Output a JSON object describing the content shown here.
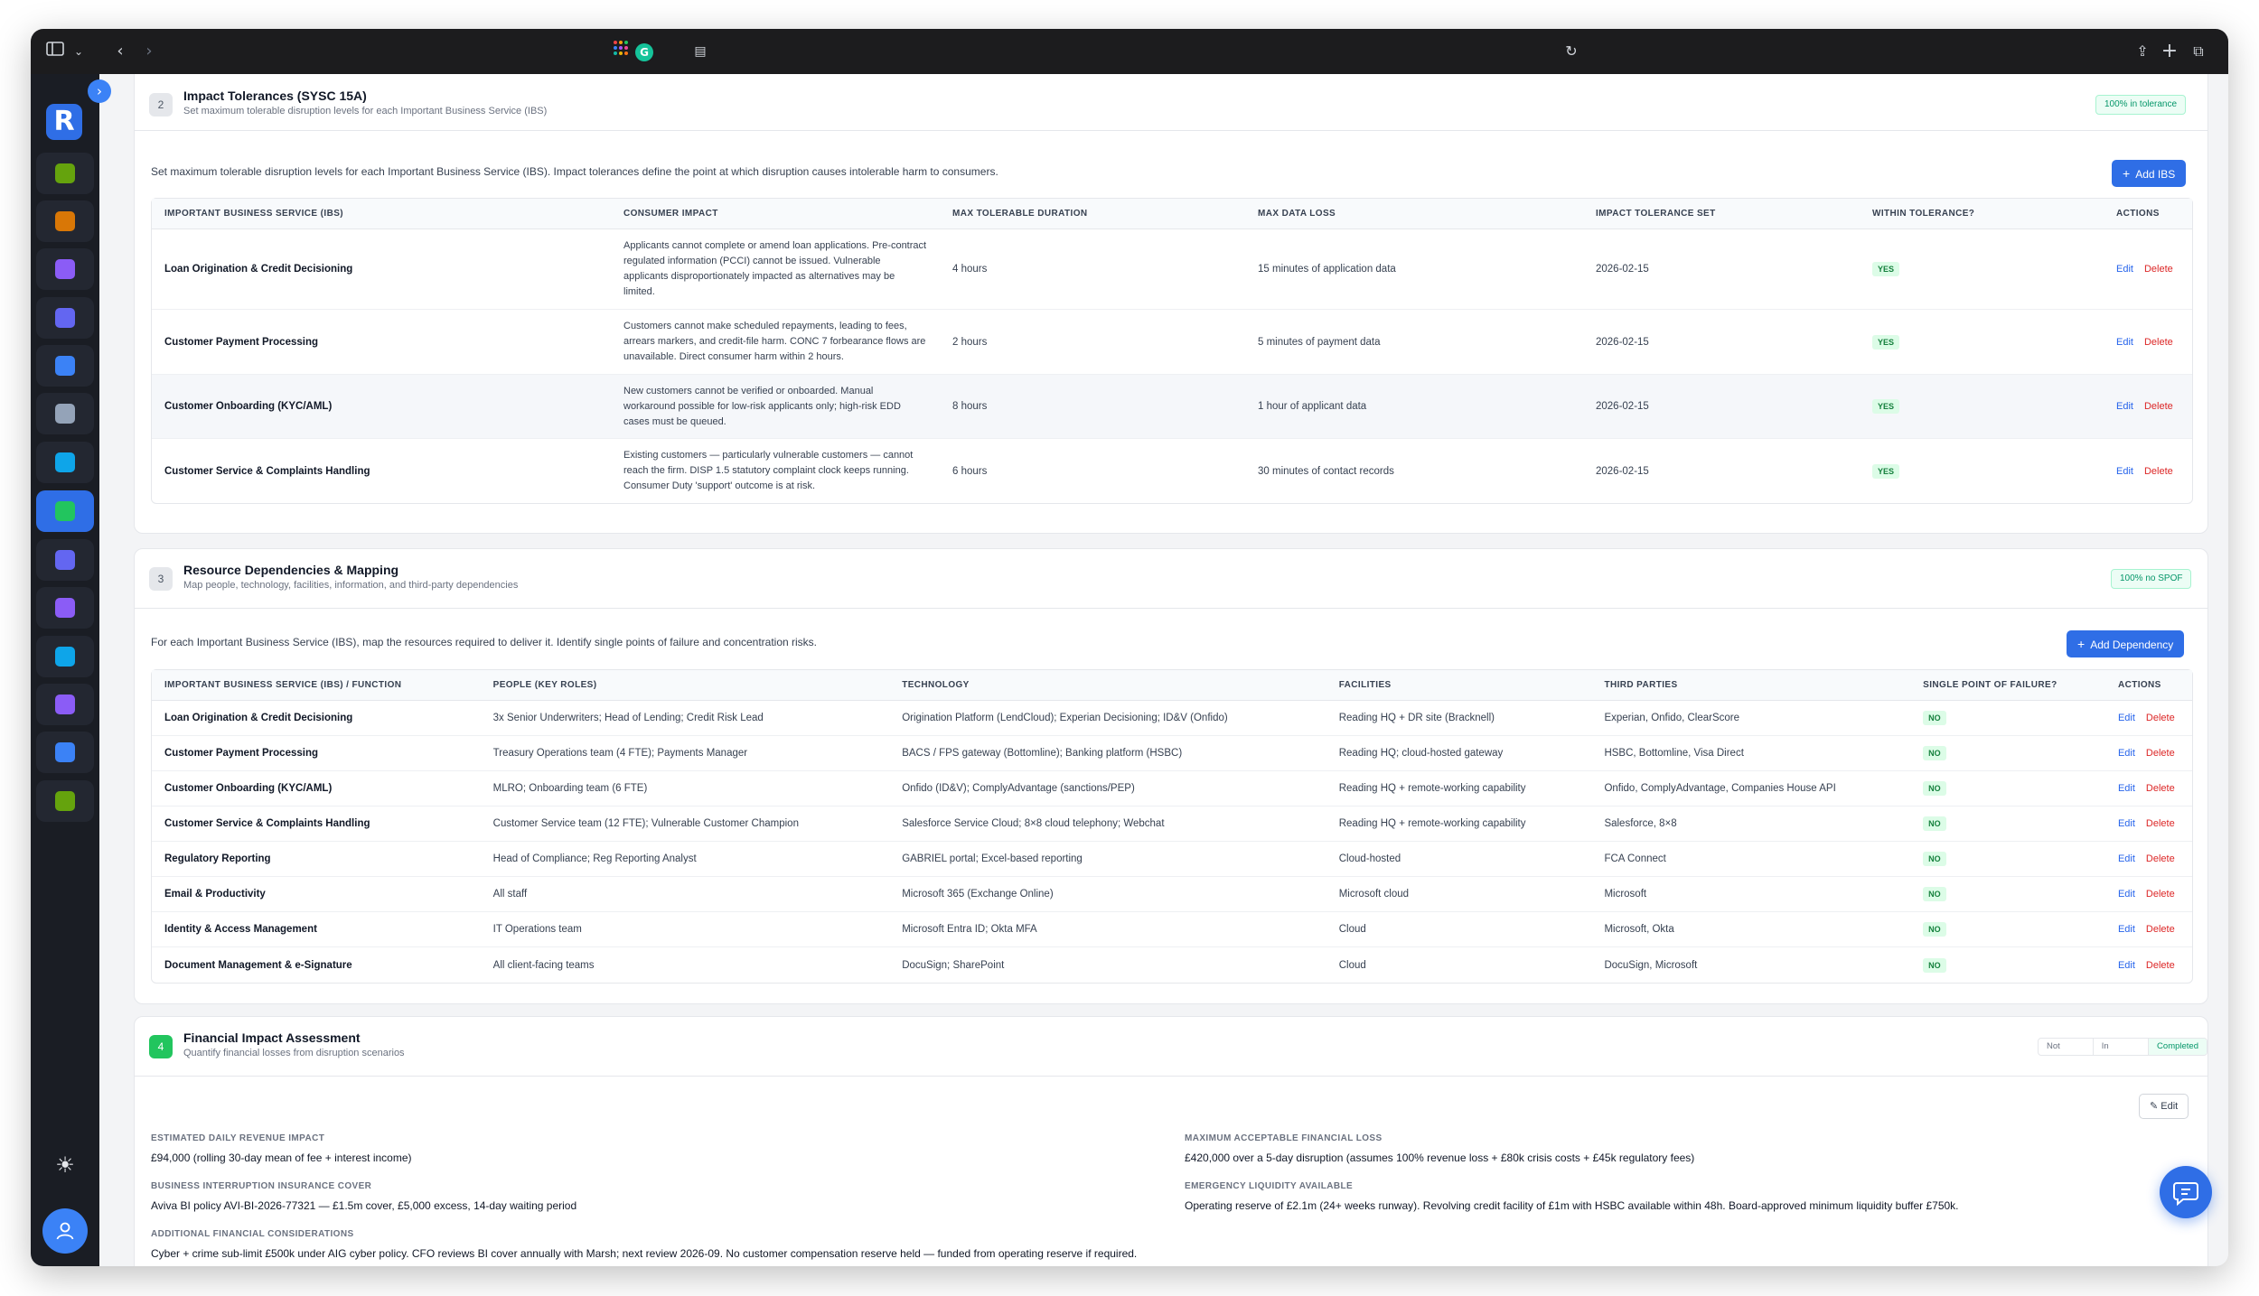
{
  "browser": {
    "icons": {
      "sidebar_toggle": "sidebar-icon",
      "chevron": "chevron-down-icon",
      "back": "back-arrow-icon",
      "forward": "forward-arrow-icon",
      "grid": "app-grid-icon",
      "grammarly": "G",
      "reader": "reader-icon",
      "reload": "reload-icon",
      "share": "share-icon",
      "new_tab": "+",
      "tabs": "tabs-icon"
    }
  },
  "sidebar": {
    "logo": "R",
    "items": [
      {
        "icon": "spreadsheet-icon",
        "color": "#65a30d"
      },
      {
        "icon": "building-icon",
        "color": "#d97706"
      },
      {
        "icon": "users-icon",
        "color": "#8b5cf6"
      },
      {
        "icon": "shield-icon",
        "color": "#6366f1"
      },
      {
        "icon": "chart-icon",
        "color": "#3b82f6"
      },
      {
        "icon": "news-icon",
        "color": "#94a3b8"
      },
      {
        "icon": "monitor-icon",
        "color": "#0ea5e9"
      },
      {
        "icon": "shield-check-icon",
        "color": "#22c55e"
      },
      {
        "icon": "target-icon",
        "color": "#6366f1"
      },
      {
        "icon": "calculator-icon",
        "color": "#8b5cf6"
      },
      {
        "icon": "lock-shield-icon",
        "color": "#0ea5e9"
      },
      {
        "icon": "list-icon",
        "color": "#8b5cf6"
      },
      {
        "icon": "report-icon",
        "color": "#3b82f6"
      },
      {
        "icon": "card-icon",
        "color": "#65a30d"
      }
    ],
    "active_index": 7
  },
  "section2": {
    "number": "2",
    "title": "Impact Tolerances (SYSC 15A)",
    "subtitle": "Set maximum tolerable disruption levels for each Important Business Service (IBS)",
    "badge": "100% in tolerance",
    "intro": "Set maximum tolerable disruption levels for each Important Business Service (IBS). Impact tolerances define the point at which disruption causes intolerable harm to consumers.",
    "add_button": "Add IBS",
    "columns": [
      "IMPORTANT BUSINESS SERVICE (IBS)",
      "CONSUMER IMPACT",
      "MAX TOLERABLE DURATION",
      "MAX DATA LOSS",
      "IMPACT TOLERANCE SET",
      "WITHIN TOLERANCE?",
      "ACTIONS"
    ],
    "rows": [
      {
        "service": "Loan Origination & Credit Decisioning",
        "impact": "Applicants cannot complete or amend loan applications. Pre-contract regulated information (PCCI) cannot be issued. Vulnerable applicants disproportionately impacted as alternatives may be limited.",
        "duration": "4 hours",
        "data_loss": "15 minutes of application data",
        "set": "2026-02-15",
        "within": "YES"
      },
      {
        "service": "Customer Payment Processing",
        "impact": "Customers cannot make scheduled repayments, leading to fees, arrears markers, and credit-file harm. CONC 7 forbearance flows are unavailable. Direct consumer harm within 2 hours.",
        "duration": "2 hours",
        "data_loss": "5 minutes of payment data",
        "set": "2026-02-15",
        "within": "YES"
      },
      {
        "service": "Customer Onboarding (KYC/AML)",
        "impact": "New customers cannot be verified or onboarded. Manual workaround possible for low-risk applicants only; high-risk EDD cases must be queued.",
        "duration": "8 hours",
        "data_loss": "1 hour of applicant data",
        "set": "2026-02-15",
        "within": "YES"
      },
      {
        "service": "Customer Service & Complaints Handling",
        "impact": "Existing customers — particularly vulnerable customers — cannot reach the firm. DISP 1.5 statutory complaint clock keeps running. Consumer Duty 'support' outcome is at risk.",
        "duration": "6 hours",
        "data_loss": "30 minutes of contact records",
        "set": "2026-02-15",
        "within": "YES"
      }
    ],
    "edit_label": "Edit",
    "delete_label": "Delete"
  },
  "section3": {
    "number": "3",
    "title": "Resource Dependencies & Mapping",
    "subtitle": "Map people, technology, facilities, information, and third-party dependencies",
    "badge": "100% no SPOF",
    "intro": "For each Important Business Service (IBS), map the resources required to deliver it. Identify single points of failure and concentration risks.",
    "add_button": "Add Dependency",
    "columns": [
      "IMPORTANT BUSINESS SERVICE (IBS) / FUNCTION",
      "PEOPLE (KEY ROLES)",
      "TECHNOLOGY",
      "FACILITIES",
      "THIRD PARTIES",
      "SINGLE POINT OF FAILURE?",
      "ACTIONS"
    ],
    "rows": [
      {
        "service": "Loan Origination & Credit Decisioning",
        "people": "3x Senior Underwriters; Head of Lending; Credit Risk Lead",
        "tech": "Origination Platform (LendCloud); Experian Decisioning; ID&V (Onfido)",
        "facilities": "Reading HQ + DR site (Bracknell)",
        "third": "Experian, Onfido, ClearScore",
        "spof": "NO"
      },
      {
        "service": "Customer Payment Processing",
        "people": "Treasury Operations team (4 FTE); Payments Manager",
        "tech": "BACS / FPS gateway (Bottomline); Banking platform (HSBC)",
        "facilities": "Reading HQ; cloud-hosted gateway",
        "third": "HSBC, Bottomline, Visa Direct",
        "spof": "NO"
      },
      {
        "service": "Customer Onboarding (KYC/AML)",
        "people": "MLRO; Onboarding team (6 FTE)",
        "tech": "Onfido (ID&V); ComplyAdvantage (sanctions/PEP)",
        "facilities": "Reading HQ + remote-working capability",
        "third": "Onfido, ComplyAdvantage, Companies House API",
        "spof": "NO"
      },
      {
        "service": "Customer Service & Complaints Handling",
        "people": "Customer Service team (12 FTE); Vulnerable Customer Champion",
        "tech": "Salesforce Service Cloud; 8×8 cloud telephony; Webchat",
        "facilities": "Reading HQ + remote-working capability",
        "third": "Salesforce, 8×8",
        "spof": "NO"
      },
      {
        "service": "Regulatory Reporting",
        "people": "Head of Compliance; Reg Reporting Analyst",
        "tech": "GABRIEL portal; Excel-based reporting",
        "facilities": "Cloud-hosted",
        "third": "FCA Connect",
        "spof": "NO"
      },
      {
        "service": "Email & Productivity",
        "people": "All staff",
        "tech": "Microsoft 365 (Exchange Online)",
        "facilities": "Microsoft cloud",
        "third": "Microsoft",
        "spof": "NO"
      },
      {
        "service": "Identity & Access Management",
        "people": "IT Operations team",
        "tech": "Microsoft Entra ID; Okta MFA",
        "facilities": "Cloud",
        "third": "Microsoft, Okta",
        "spof": "NO"
      },
      {
        "service": "Document Management & e-Signature",
        "people": "All client-facing teams",
        "tech": "DocuSign; SharePoint",
        "facilities": "Cloud",
        "third": "DocuSign, Microsoft",
        "spof": "NO"
      }
    ],
    "edit_label": "Edit",
    "delete_label": "Delete"
  },
  "section4": {
    "number": "4",
    "title": "Financial Impact Assessment",
    "subtitle": "Quantify financial losses from disruption scenarios",
    "status_options": [
      "Not Started",
      "In Progress",
      "Completed"
    ],
    "status_selected": "Completed",
    "edit_button": "Edit",
    "fields": {
      "daily_revenue_label": "ESTIMATED DAILY REVENUE IMPACT",
      "daily_revenue_value": "£94,000 (rolling 30-day mean of fee + interest income)",
      "max_loss_label": "MAXIMUM ACCEPTABLE FINANCIAL LOSS",
      "max_loss_value": "£420,000 over a 5-day disruption (assumes 100% revenue loss + £80k crisis costs + £45k regulatory fees)",
      "bi_cover_label": "BUSINESS INTERRUPTION INSURANCE COVER",
      "bi_cover_value": "Aviva BI policy AVI-BI-2026-77321 — £1.5m cover, £5,000 excess, 14-day waiting period",
      "liquidity_label": "EMERGENCY LIQUIDITY AVAILABLE",
      "liquidity_value": "Operating reserve of £2.1m (24+ weeks runway). Revolving credit facility of £1m with HSBC available within 48h. Board-approved minimum liquidity buffer £750k.",
      "additional_label": "ADDITIONAL FINANCIAL CONSIDERATIONS",
      "additional_value": "Cyber + crime sub-limit £500k under AIG cyber policy. CFO reviews BI cover annually with Marsh; next review 2026-09. No customer compensation reserve held — funded from operating reserve if required."
    }
  },
  "chat": {
    "icon": "chat-icon"
  }
}
